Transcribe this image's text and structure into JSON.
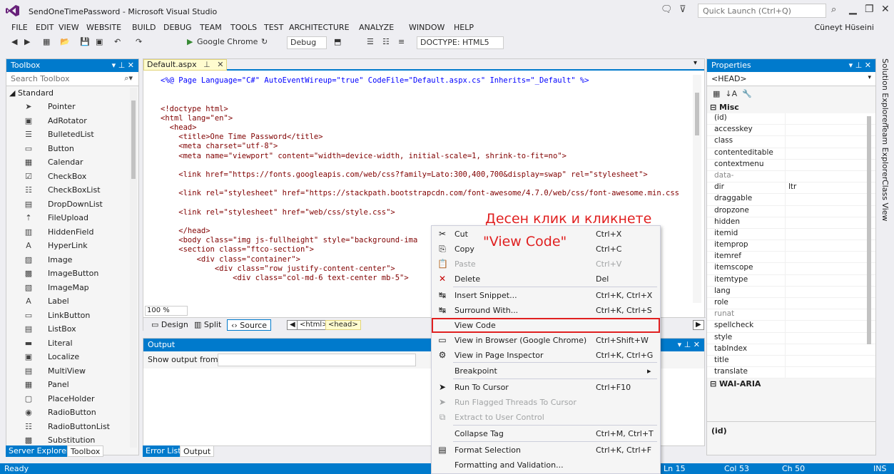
{
  "titlebar": {
    "title": "SendOneTimePassword - Microsoft Visual Studio",
    "quick_launch_placeholder": "Quick Launch (Ctrl+Q)",
    "icons": [
      "notification-icon",
      "filter-icon"
    ]
  },
  "menu": {
    "items": [
      "FILE",
      "EDIT",
      "VIEW",
      "WEBSITE",
      "BUILD",
      "DEBUG",
      "TEAM",
      "TOOLS",
      "TEST",
      "ARCHITECTURE",
      "ANALYZE",
      "WINDOW",
      "HELP"
    ],
    "user": "Cüneyt Hüseini"
  },
  "toolbar": {
    "browser": "Google Chrome",
    "config": "Debug",
    "doctype": "DOCTYPE: HTML5"
  },
  "toolbox": {
    "title": "Toolbox",
    "search_placeholder": "Search Toolbox",
    "group": "Standard",
    "items": [
      "Pointer",
      "AdRotator",
      "BulletedList",
      "Button",
      "Calendar",
      "CheckBox",
      "CheckBoxList",
      "DropDownList",
      "FileUpload",
      "HiddenField",
      "HyperLink",
      "Image",
      "ImageButton",
      "ImageMap",
      "Label",
      "LinkButton",
      "ListBox",
      "Literal",
      "Localize",
      "MultiView",
      "Panel",
      "PlaceHolder",
      "RadioButton",
      "RadioButtonList",
      "Substitution"
    ],
    "tabs": [
      "Server Explorer",
      "Toolbox"
    ]
  },
  "editor": {
    "tab": "Default.aspx",
    "zoom": "100 %",
    "views": [
      "Design",
      "Split",
      "Source"
    ],
    "breadcrumbs": [
      "<html>",
      "<head>"
    ]
  },
  "output": {
    "title": "Output",
    "show_from": "Show output from:",
    "tabs": [
      "Error List",
      "Output"
    ]
  },
  "properties": {
    "title": "Properties",
    "object": "<HEAD>",
    "category_misc": "Misc",
    "rows": [
      {
        "k": "(id)",
        "v": ""
      },
      {
        "k": "accesskey",
        "v": ""
      },
      {
        "k": "class",
        "v": ""
      },
      {
        "k": "contenteditable",
        "v": ""
      },
      {
        "k": "contextmenu",
        "v": ""
      },
      {
        "k": "data-",
        "v": "",
        "dim": true
      },
      {
        "k": "dir",
        "v": "ltr"
      },
      {
        "k": "draggable",
        "v": ""
      },
      {
        "k": "dropzone",
        "v": ""
      },
      {
        "k": "hidden",
        "v": ""
      },
      {
        "k": "itemid",
        "v": ""
      },
      {
        "k": "itemprop",
        "v": ""
      },
      {
        "k": "itemref",
        "v": ""
      },
      {
        "k": "itemscope",
        "v": ""
      },
      {
        "k": "itemtype",
        "v": ""
      },
      {
        "k": "lang",
        "v": ""
      },
      {
        "k": "role",
        "v": ""
      },
      {
        "k": "runat",
        "v": "",
        "dim": true
      },
      {
        "k": "spellcheck",
        "v": ""
      },
      {
        "k": "style",
        "v": ""
      },
      {
        "k": "tabIndex",
        "v": ""
      },
      {
        "k": "title",
        "v": ""
      },
      {
        "k": "translate",
        "v": ""
      }
    ],
    "category_aria": "WAI-ARIA",
    "description": "(id)"
  },
  "side_tabs": [
    "Solution Explorer",
    "Team Explorer",
    "Class View"
  ],
  "status": {
    "ready": "Ready",
    "ln": "Ln 15",
    "col": "Col 53",
    "ch": "Ch 50",
    "ins": "INS"
  },
  "context_menu": [
    {
      "label": "Cut",
      "shortcut": "Ctrl+X",
      "icon": "cut-icon",
      "disabled": false
    },
    {
      "label": "Copy",
      "shortcut": "Ctrl+C",
      "icon": "copy-icon",
      "disabled": false
    },
    {
      "label": "Paste",
      "shortcut": "Ctrl+V",
      "icon": "paste-icon",
      "disabled": true
    },
    {
      "label": "Delete",
      "shortcut": "Del",
      "icon": "delete-icon",
      "disabled": false
    },
    {
      "label": "Insert Snippet...",
      "shortcut": "Ctrl+K, Ctrl+X",
      "icon": "snippet-icon",
      "disabled": false
    },
    {
      "label": "Surround With...",
      "shortcut": "Ctrl+K, Ctrl+S",
      "icon": "surround-icon",
      "disabled": false
    },
    {
      "label": "View Code",
      "shortcut": "",
      "icon": "",
      "disabled": false
    },
    {
      "label": "View in Browser (Google Chrome)",
      "shortcut": "Ctrl+Shift+W",
      "icon": "browser-icon",
      "disabled": false
    },
    {
      "label": "View in Page Inspector",
      "shortcut": "Ctrl+K, Ctrl+G",
      "icon": "inspector-icon",
      "disabled": false
    },
    {
      "label": "Breakpoint",
      "shortcut": "",
      "icon": "",
      "disabled": false
    },
    {
      "label": "Run To Cursor",
      "shortcut": "Ctrl+F10",
      "icon": "run-cursor-icon",
      "disabled": false
    },
    {
      "label": "Run Flagged Threads To Cursor",
      "shortcut": "",
      "icon": "run-flagged-icon",
      "disabled": true
    },
    {
      "label": "Extract to User Control",
      "shortcut": "",
      "icon": "extract-icon",
      "disabled": true
    },
    {
      "label": "Collapse Tag",
      "shortcut": "Ctrl+M, Ctrl+T",
      "icon": "",
      "disabled": false
    },
    {
      "label": "Format Selection",
      "shortcut": "Ctrl+K, Ctrl+F",
      "icon": "format-icon",
      "disabled": false
    },
    {
      "label": "Formatting and Validation...",
      "shortcut": "",
      "icon": "",
      "disabled": false
    }
  ],
  "annotation": {
    "line1": "Десен клик и кликнете",
    "line2": "\"View Code\""
  },
  "code_lines": [
    "<%@ Page Language=\"C#\" AutoEventWireup=\"true\" CodeFile=\"Default.aspx.cs\" Inherits=\"_Default\" %>",
    "",
    "",
    "<!doctype html>",
    "<html lang=\"en\">",
    "  <head>",
    "    <title>One Time Password</title>",
    "    <meta charset=\"utf-8\">",
    "    <meta name=\"viewport\" content=\"width=device-width, initial-scale=1, shrink-to-fit=no\">",
    "",
    "    <link href=\"https://fonts.googleapis.com/web/css?family=Lato:300,400,700&display=swap\" rel=\"stylesheet\">",
    "",
    "    <link rel=\"stylesheet\" href=\"https://stackpath.bootstrapcdn.com/font-awesome/4.7.0/web/css/font-awesome.min.css",
    "",
    "    <link rel=\"stylesheet\" href=\"web/css/style.css\">",
    "",
    "    </head>",
    "    <body class=\"img js-fullheight\" style=\"background-ima",
    "    <section class=\"ftco-section\">",
    "        <div class=\"container\">",
    "            <div class=\"row justify-content-center\">",
    "                <div class=\"col-md-6 text-center mb-5\">"
  ]
}
